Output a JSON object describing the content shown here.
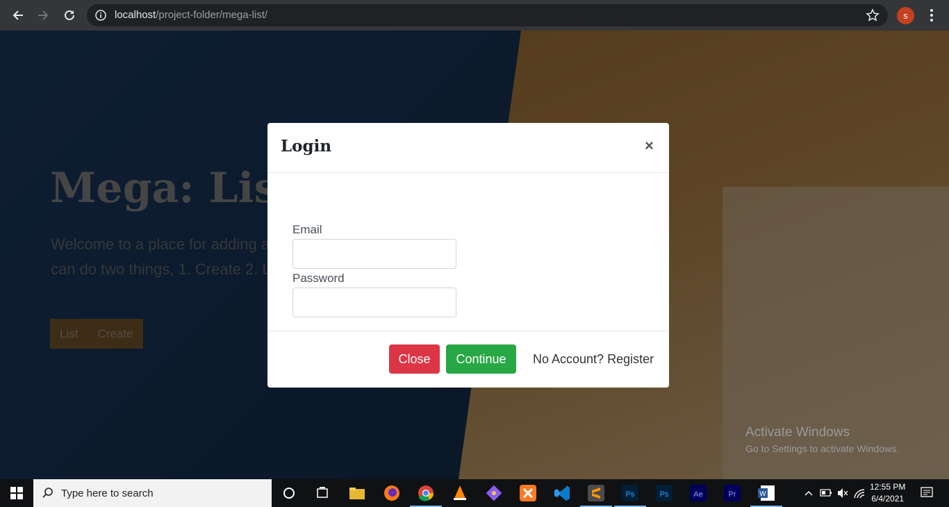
{
  "browser": {
    "url_host": "localhost",
    "url_path": "/project-folder/mega-list/",
    "profile_initial": "s"
  },
  "hero": {
    "title": "Mega: Lis",
    "subtitle": "Welcome to a place for adding a can do two things, 1. Create 2. Li",
    "buttons": [
      "List",
      "Create"
    ]
  },
  "modal": {
    "title": "Login",
    "close_symbol": "×",
    "email_label": "Email",
    "email_value": "",
    "password_label": "Password",
    "password_value": "",
    "close_button": "Close",
    "continue_button": "Continue",
    "register_link": "No Account? Register"
  },
  "watermark": {
    "line1": "Activate Windows",
    "line2": "Go to Settings to activate Windows."
  },
  "taskbar": {
    "search_placeholder": "Type here to search",
    "apps": [
      "cortana-icon",
      "task-view-icon",
      "file-explorer-icon",
      "firefox-icon",
      "chrome-icon",
      "vlc-icon",
      "git-icon",
      "xampp-icon",
      "vscode-icon",
      "sublime-icon",
      "photoshop-icon",
      "photoshop-icon",
      "after-effects-icon",
      "premiere-icon",
      "word-icon"
    ],
    "time": "12:55 PM",
    "date": "6/4/2021"
  },
  "colors": {
    "danger": "#dc3545",
    "success": "#28a745",
    "browser_chrome": "#35363a"
  }
}
